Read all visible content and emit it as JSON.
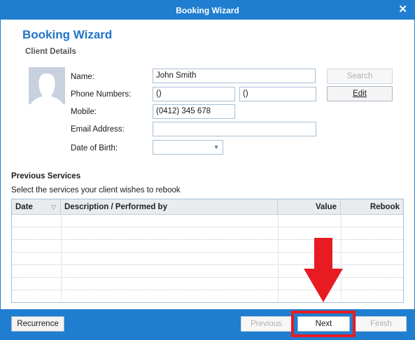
{
  "window": {
    "title": "Booking Wizard",
    "close_glyph": "✕"
  },
  "header": {
    "heading": "Booking Wizard",
    "subheading": "Client Details"
  },
  "client": {
    "name_label": "Name:",
    "name_value": "John Smith",
    "phone_label": "Phone Numbers:",
    "phone1_value": "()",
    "phone2_value": "()",
    "mobile_label": "Mobile:",
    "mobile_value": "(0412) 345 678",
    "email_label": "Email Address:",
    "email_value": "",
    "dob_label": "Date of Birth:",
    "dob_value": ""
  },
  "buttons": {
    "search": "Search",
    "edit": "Edit",
    "recurrence": "Recurrence",
    "previous": "Previous",
    "next": "Next",
    "finish": "Finish"
  },
  "services": {
    "title": "Previous Services",
    "subtitle": "Select the services your client wishes to rebook",
    "columns": [
      "Date",
      "Description / Performed by",
      "Value",
      "Rebook"
    ],
    "rows": []
  },
  "icons": {
    "close": "close-icon",
    "avatar": "person-silhouette-icon",
    "dropdown": "chevron-down-icon",
    "sort": "sort-triangle-icon",
    "annotation": "red-down-arrow-icon"
  },
  "colors": {
    "accent": "#1f7ed0",
    "heading": "#1f74c8",
    "annotation_red": "#e81b22",
    "avatar_bg": "#c8d1de"
  }
}
